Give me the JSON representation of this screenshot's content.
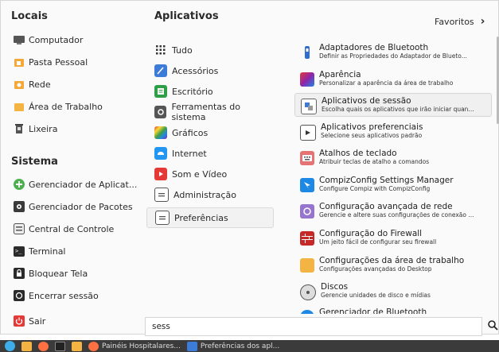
{
  "left": {
    "locais_title": "Locais",
    "locais": [
      {
        "label": "Computador",
        "icon": "computer-icon"
      },
      {
        "label": "Pasta Pessoal",
        "icon": "home-folder-icon"
      },
      {
        "label": "Rede",
        "icon": "network-icon"
      },
      {
        "label": "Área de Trabalho",
        "icon": "desktop-folder-icon"
      },
      {
        "label": "Lixeira",
        "icon": "trash-icon"
      }
    ],
    "sistema_title": "Sistema",
    "sistema": [
      {
        "label": "Gerenciador de Aplicat...",
        "icon": "software-manager-icon"
      },
      {
        "label": "Gerenciador de Pacotes",
        "icon": "package-manager-icon"
      },
      {
        "label": "Central de Controle",
        "icon": "control-center-icon"
      },
      {
        "label": "Terminal",
        "icon": "terminal-icon"
      },
      {
        "label": "Bloquear Tela",
        "icon": "lock-icon"
      },
      {
        "label": "Encerrar sessão",
        "icon": "logout-icon"
      },
      {
        "label": "Sair",
        "icon": "power-icon"
      }
    ]
  },
  "categories": {
    "title": "Aplicativos",
    "items": [
      {
        "label": "Tudo",
        "icon": "grid-icon"
      },
      {
        "label": "Acessórios",
        "icon": "accessories-icon"
      },
      {
        "label": "Escritório",
        "icon": "office-icon"
      },
      {
        "label": "Ferramentas do sistema",
        "icon": "system-tools-icon"
      },
      {
        "label": "Gráficos",
        "icon": "graphics-icon"
      },
      {
        "label": "Internet",
        "icon": "internet-icon"
      },
      {
        "label": "Som e Vídeo",
        "icon": "multimedia-icon"
      },
      {
        "label": "Administração",
        "icon": "administration-icon"
      },
      {
        "label": "Preferências",
        "icon": "preferences-icon"
      }
    ],
    "active": "Preferências"
  },
  "favorites_label": "Favoritos",
  "apps": [
    {
      "name": "Adaptadores de Bluetooth",
      "desc": "Definir as Propriedades do Adaptador de Blueto...",
      "icon": "bluetooth-adapter-icon"
    },
    {
      "name": "Aparência",
      "desc": "Personalizar a aparência da área de trabalho",
      "icon": "appearance-icon"
    },
    {
      "name": "Aplicativos de sessão",
      "desc": "Escolha quais os aplicativos que irão iniciar quan...",
      "icon": "session-apps-icon"
    },
    {
      "name": "Aplicativos preferenciais",
      "desc": "Selecione seus aplicativos padrão",
      "icon": "preferred-apps-icon"
    },
    {
      "name": "Atalhos de teclado",
      "desc": "Atribuir teclas de atalho a comandos",
      "icon": "keyboard-shortcuts-icon"
    },
    {
      "name": "CompizConfig Settings Manager",
      "desc": "Configure Compiz with CompizConfig",
      "icon": "compiz-icon"
    },
    {
      "name": "Configuração avançada de rede",
      "desc": "Gerencie e altere suas configurações de conexão ...",
      "icon": "network-config-icon"
    },
    {
      "name": "Configuração do Firewall",
      "desc": "Um jeito fácil de configurar seu firewall",
      "icon": "firewall-icon"
    },
    {
      "name": "Configurações da área de trabalho",
      "desc": "Configurações avançadas do Desktop",
      "icon": "desktop-settings-icon"
    },
    {
      "name": "Discos",
      "desc": "Gerencie unidades de disco e mídias",
      "icon": "disks-icon"
    },
    {
      "name": "Gerenciador de Bluetooth",
      "desc": "",
      "icon": "bluetooth-manager-icon"
    }
  ],
  "highlighted_app": "Aplicativos de sessão",
  "search": {
    "value": "sess"
  },
  "taskbar": {
    "items": [
      {
        "label": "",
        "icon": "start-menu-icon"
      },
      {
        "label": "",
        "icon": "folder-icon"
      },
      {
        "label": "",
        "icon": "firefox-icon"
      },
      {
        "label": "",
        "icon": "terminal-icon"
      },
      {
        "label": "",
        "icon": "folder-icon"
      },
      {
        "label": "Painéis Hospitalares...",
        "icon": "firefox-icon"
      },
      {
        "label": "Preferências dos apl...",
        "icon": "preferences-icon"
      }
    ]
  },
  "colors": {
    "accent": "#3daee9",
    "taskbar": "#3b3b3b"
  }
}
